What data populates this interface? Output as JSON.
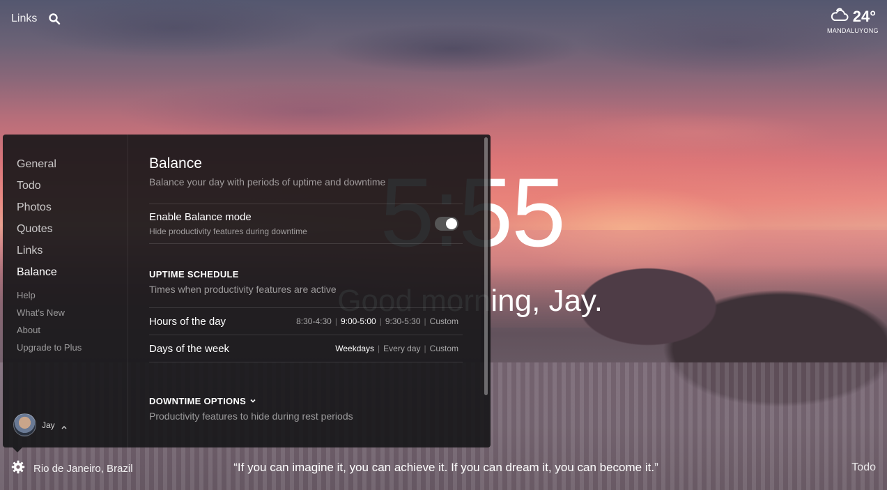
{
  "topbar": {
    "links_label": "Links",
    "search_icon": "search-icon"
  },
  "weather": {
    "temp": "24°",
    "location": "MANDALUYONG",
    "icon": "cloud-icon"
  },
  "clock": {
    "time": "5:55"
  },
  "greeting": {
    "text": "Good morning, Jay."
  },
  "settings": {
    "nav": {
      "main": [
        "General",
        "Todo",
        "Photos",
        "Quotes",
        "Links",
        "Balance"
      ],
      "active": "Balance",
      "secondary": [
        "Help",
        "What's New",
        "About",
        "Upgrade to Plus"
      ]
    },
    "user": {
      "name": "Jay"
    },
    "balance": {
      "title": "Balance",
      "subtitle": "Balance your day with periods of uptime and downtime",
      "enable_label": "Enable Balance mode",
      "enable_desc": "Hide productivity features during downtime",
      "enabled": true,
      "uptime_title": "UPTIME SCHEDULE",
      "uptime_desc": "Times when productivity features are active",
      "hours_label": "Hours of the day",
      "hours_options": [
        "8:30-4:30",
        "9:00-5:00",
        "9:30-5:30",
        "Custom"
      ],
      "hours_selected": "9:00-5:00",
      "days_label": "Days of the week",
      "days_options": [
        "Weekdays",
        "Every day",
        "Custom"
      ],
      "days_selected": "Weekdays",
      "downtime_title": "DOWNTIME OPTIONS",
      "downtime_desc": "Productivity features to hide during rest periods"
    }
  },
  "bottom": {
    "location": "Rio de Janeiro, Brazil",
    "quote": "“If you can imagine it, you can achieve it. If you can dream it, you can become it.”",
    "todo_label": "Todo"
  }
}
